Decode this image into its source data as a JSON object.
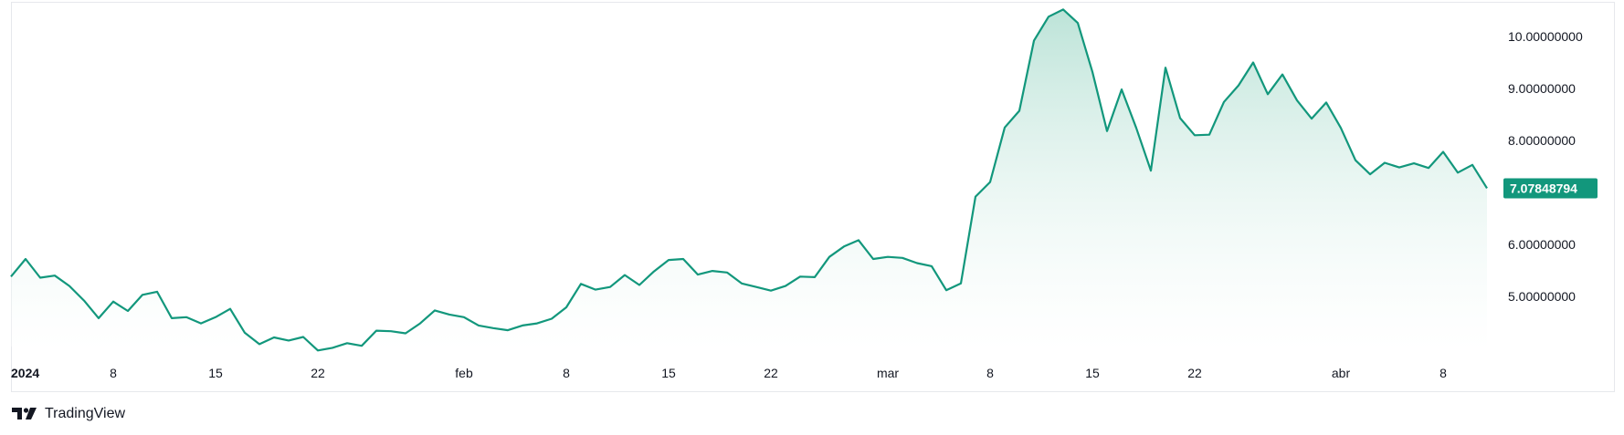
{
  "brand": {
    "name": "TradingView",
    "icon": "tradingview-logo-icon"
  },
  "colors": {
    "line": "#12977c",
    "fill_top": "#b9e2d6",
    "fill_bottom": "#ffffff",
    "price_tag_bg": "#12977c",
    "text": "#131722",
    "border": "#e6e8ec"
  },
  "chart_data": {
    "type": "area",
    "title": "",
    "xlabel": "",
    "ylabel": "",
    "last_price_label": "7.07848794",
    "y_axis_position": "right",
    "grid": false,
    "ylim": [
      3.9,
      10.6
    ],
    "y_ticks": [
      {
        "value": 5,
        "label": "5.00000000"
      },
      {
        "value": 6,
        "label": "6.00000000"
      },
      {
        "value": 8,
        "label": "8.00000000"
      },
      {
        "value": 9,
        "label": "9.00000000"
      },
      {
        "value": 10,
        "label": "10.00000000"
      }
    ],
    "x_ticks": [
      {
        "date": "2024-01-01",
        "label": "2024",
        "bold": true
      },
      {
        "date": "2024-01-08",
        "label": "8"
      },
      {
        "date": "2024-01-15",
        "label": "15"
      },
      {
        "date": "2024-01-22",
        "label": "22"
      },
      {
        "date": "2024-02-01",
        "label": "feb"
      },
      {
        "date": "2024-02-08",
        "label": "8"
      },
      {
        "date": "2024-02-15",
        "label": "15"
      },
      {
        "date": "2024-02-22",
        "label": "22"
      },
      {
        "date": "2024-03-01",
        "label": "mar"
      },
      {
        "date": "2024-03-08",
        "label": "8"
      },
      {
        "date": "2024-03-15",
        "label": "15"
      },
      {
        "date": "2024-03-22",
        "label": "22"
      },
      {
        "date": "2024-04-01",
        "label": "abr"
      },
      {
        "date": "2024-04-08",
        "label": "8"
      }
    ],
    "series": [
      {
        "x_start": "2024-01-01",
        "x_step_days": 1,
        "values": [
          5.38,
          5.72,
          5.36,
          5.4,
          5.2,
          4.92,
          4.58,
          4.9,
          4.72,
          5.03,
          5.09,
          4.58,
          4.6,
          4.48,
          4.6,
          4.76,
          4.3,
          4.08,
          4.21,
          4.15,
          4.22,
          3.96,
          4.01,
          4.1,
          4.05,
          4.34,
          4.33,
          4.29,
          4.48,
          4.73,
          4.65,
          4.6,
          4.44,
          4.39,
          4.35,
          4.44,
          4.48,
          4.57,
          4.79,
          5.24,
          5.13,
          5.18,
          5.41,
          5.22,
          5.48,
          5.7,
          5.72,
          5.42,
          5.49,
          5.46,
          5.25,
          5.18,
          5.11,
          5.2,
          5.38,
          5.37,
          5.76,
          5.96,
          6.08,
          5.72,
          5.76,
          5.74,
          5.64,
          5.58,
          5.12,
          5.25,
          6.92,
          7.2,
          8.25,
          8.57,
          9.92,
          10.38,
          10.52,
          10.26,
          9.32,
          8.18,
          8.98,
          8.24,
          7.42,
          9.4,
          8.43,
          8.1,
          8.11,
          8.74,
          9.06,
          9.5,
          8.89,
          9.27,
          8.77,
          8.42,
          8.73,
          8.24,
          7.62,
          7.35,
          7.57,
          7.48,
          7.56,
          7.47,
          7.78,
          7.38,
          7.53,
          7.08
        ]
      }
    ]
  }
}
